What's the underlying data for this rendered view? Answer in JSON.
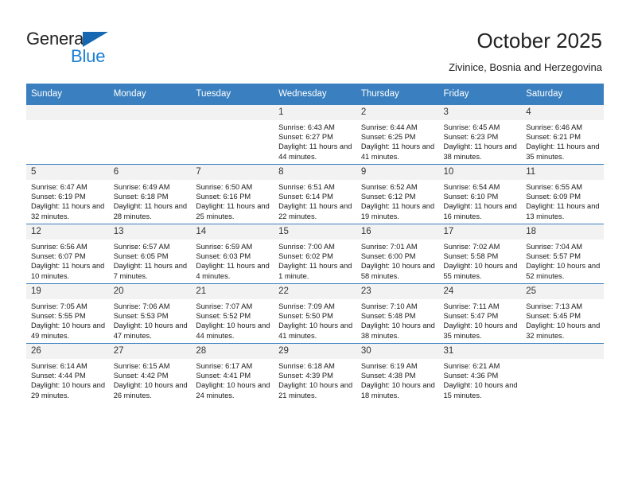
{
  "brand": {
    "name_part1": "General",
    "name_part2": "Blue",
    "triangle_color": "#1667b2",
    "blue_color": "#1a7fd4"
  },
  "header": {
    "title": "October 2025",
    "subtitle": "Zivinice, Bosnia and Herzegovina"
  },
  "colors": {
    "header_row_bg": "#3a7fbf",
    "daynum_bg": "#f2f2f2",
    "grid_line": "#3a7fbf",
    "text": "#1a1a1a"
  },
  "weekdays": [
    "Sunday",
    "Monday",
    "Tuesday",
    "Wednesday",
    "Thursday",
    "Friday",
    "Saturday"
  ],
  "labels": {
    "sunrise_prefix": "Sunrise:",
    "sunset_prefix": "Sunset:",
    "daylight_prefix": "Daylight:"
  },
  "weeks": [
    [
      {
        "day": "",
        "blank": true
      },
      {
        "day": "",
        "blank": true
      },
      {
        "day": "",
        "blank": true
      },
      {
        "day": "1",
        "sunrise": "Sunrise: 6:43 AM",
        "sunset": "Sunset: 6:27 PM",
        "daylight": "Daylight: 11 hours and 44 minutes."
      },
      {
        "day": "2",
        "sunrise": "Sunrise: 6:44 AM",
        "sunset": "Sunset: 6:25 PM",
        "daylight": "Daylight: 11 hours and 41 minutes."
      },
      {
        "day": "3",
        "sunrise": "Sunrise: 6:45 AM",
        "sunset": "Sunset: 6:23 PM",
        "daylight": "Daylight: 11 hours and 38 minutes."
      },
      {
        "day": "4",
        "sunrise": "Sunrise: 6:46 AM",
        "sunset": "Sunset: 6:21 PM",
        "daylight": "Daylight: 11 hours and 35 minutes."
      }
    ],
    [
      {
        "day": "5",
        "sunrise": "Sunrise: 6:47 AM",
        "sunset": "Sunset: 6:19 PM",
        "daylight": "Daylight: 11 hours and 32 minutes."
      },
      {
        "day": "6",
        "sunrise": "Sunrise: 6:49 AM",
        "sunset": "Sunset: 6:18 PM",
        "daylight": "Daylight: 11 hours and 28 minutes."
      },
      {
        "day": "7",
        "sunrise": "Sunrise: 6:50 AM",
        "sunset": "Sunset: 6:16 PM",
        "daylight": "Daylight: 11 hours and 25 minutes."
      },
      {
        "day": "8",
        "sunrise": "Sunrise: 6:51 AM",
        "sunset": "Sunset: 6:14 PM",
        "daylight": "Daylight: 11 hours and 22 minutes."
      },
      {
        "day": "9",
        "sunrise": "Sunrise: 6:52 AM",
        "sunset": "Sunset: 6:12 PM",
        "daylight": "Daylight: 11 hours and 19 minutes."
      },
      {
        "day": "10",
        "sunrise": "Sunrise: 6:54 AM",
        "sunset": "Sunset: 6:10 PM",
        "daylight": "Daylight: 11 hours and 16 minutes."
      },
      {
        "day": "11",
        "sunrise": "Sunrise: 6:55 AM",
        "sunset": "Sunset: 6:09 PM",
        "daylight": "Daylight: 11 hours and 13 minutes."
      }
    ],
    [
      {
        "day": "12",
        "sunrise": "Sunrise: 6:56 AM",
        "sunset": "Sunset: 6:07 PM",
        "daylight": "Daylight: 11 hours and 10 minutes."
      },
      {
        "day": "13",
        "sunrise": "Sunrise: 6:57 AM",
        "sunset": "Sunset: 6:05 PM",
        "daylight": "Daylight: 11 hours and 7 minutes."
      },
      {
        "day": "14",
        "sunrise": "Sunrise: 6:59 AM",
        "sunset": "Sunset: 6:03 PM",
        "daylight": "Daylight: 11 hours and 4 minutes."
      },
      {
        "day": "15",
        "sunrise": "Sunrise: 7:00 AM",
        "sunset": "Sunset: 6:02 PM",
        "daylight": "Daylight: 11 hours and 1 minute."
      },
      {
        "day": "16",
        "sunrise": "Sunrise: 7:01 AM",
        "sunset": "Sunset: 6:00 PM",
        "daylight": "Daylight: 10 hours and 58 minutes."
      },
      {
        "day": "17",
        "sunrise": "Sunrise: 7:02 AM",
        "sunset": "Sunset: 5:58 PM",
        "daylight": "Daylight: 10 hours and 55 minutes."
      },
      {
        "day": "18",
        "sunrise": "Sunrise: 7:04 AM",
        "sunset": "Sunset: 5:57 PM",
        "daylight": "Daylight: 10 hours and 52 minutes."
      }
    ],
    [
      {
        "day": "19",
        "sunrise": "Sunrise: 7:05 AM",
        "sunset": "Sunset: 5:55 PM",
        "daylight": "Daylight: 10 hours and 49 minutes."
      },
      {
        "day": "20",
        "sunrise": "Sunrise: 7:06 AM",
        "sunset": "Sunset: 5:53 PM",
        "daylight": "Daylight: 10 hours and 47 minutes."
      },
      {
        "day": "21",
        "sunrise": "Sunrise: 7:07 AM",
        "sunset": "Sunset: 5:52 PM",
        "daylight": "Daylight: 10 hours and 44 minutes."
      },
      {
        "day": "22",
        "sunrise": "Sunrise: 7:09 AM",
        "sunset": "Sunset: 5:50 PM",
        "daylight": "Daylight: 10 hours and 41 minutes."
      },
      {
        "day": "23",
        "sunrise": "Sunrise: 7:10 AM",
        "sunset": "Sunset: 5:48 PM",
        "daylight": "Daylight: 10 hours and 38 minutes."
      },
      {
        "day": "24",
        "sunrise": "Sunrise: 7:11 AM",
        "sunset": "Sunset: 5:47 PM",
        "daylight": "Daylight: 10 hours and 35 minutes."
      },
      {
        "day": "25",
        "sunrise": "Sunrise: 7:13 AM",
        "sunset": "Sunset: 5:45 PM",
        "daylight": "Daylight: 10 hours and 32 minutes."
      }
    ],
    [
      {
        "day": "26",
        "sunrise": "Sunrise: 6:14 AM",
        "sunset": "Sunset: 4:44 PM",
        "daylight": "Daylight: 10 hours and 29 minutes."
      },
      {
        "day": "27",
        "sunrise": "Sunrise: 6:15 AM",
        "sunset": "Sunset: 4:42 PM",
        "daylight": "Daylight: 10 hours and 26 minutes."
      },
      {
        "day": "28",
        "sunrise": "Sunrise: 6:17 AM",
        "sunset": "Sunset: 4:41 PM",
        "daylight": "Daylight: 10 hours and 24 minutes."
      },
      {
        "day": "29",
        "sunrise": "Sunrise: 6:18 AM",
        "sunset": "Sunset: 4:39 PM",
        "daylight": "Daylight: 10 hours and 21 minutes."
      },
      {
        "day": "30",
        "sunrise": "Sunrise: 6:19 AM",
        "sunset": "Sunset: 4:38 PM",
        "daylight": "Daylight: 10 hours and 18 minutes."
      },
      {
        "day": "31",
        "sunrise": "Sunrise: 6:21 AM",
        "sunset": "Sunset: 4:36 PM",
        "daylight": "Daylight: 10 hours and 15 minutes."
      },
      {
        "day": "",
        "blank": true
      }
    ]
  ]
}
